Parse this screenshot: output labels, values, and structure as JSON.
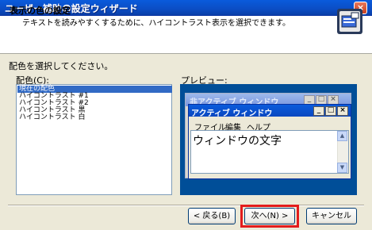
{
  "window": {
    "title": "ユーザー補助の設定ウィザード",
    "close_glyph": "×"
  },
  "header": {
    "title": "表示の色の設定",
    "subtitle": "テキストを読みやすくするために、ハイコントラスト表示を選択できます。",
    "icon": "display-settings-icon"
  },
  "instruction": "配色を選択してください。",
  "scheme": {
    "label": "配色(C):",
    "items": [
      "現在の配色",
      "ハイコントラスト #1",
      "ハイコントラスト #2",
      "ハイコントラスト 黒",
      "ハイコントラスト 白"
    ],
    "selected_index": 0
  },
  "preview": {
    "label": "プレビュー:",
    "inactive_title": "非アクティブ ウィンドウ",
    "active_title": "アクティブ ウィンドウ",
    "menu": [
      "ファイル",
      "編集",
      "ヘルプ"
    ],
    "window_text": "ウィンドウの文字",
    "caption_buttons": {
      "minimize": "_",
      "maximize": "□",
      "close": "×"
    },
    "scroll_up": "▲",
    "scroll_down": "▼",
    "colors": {
      "background": "#004e98",
      "active_title": "#0a5bdc",
      "inactive_title": "#9db9eb"
    }
  },
  "buttons": {
    "back": "< 戻る(B)",
    "next": "次へ(N) >",
    "cancel": "キャンセル"
  },
  "highlight_color": "#e31c1c"
}
